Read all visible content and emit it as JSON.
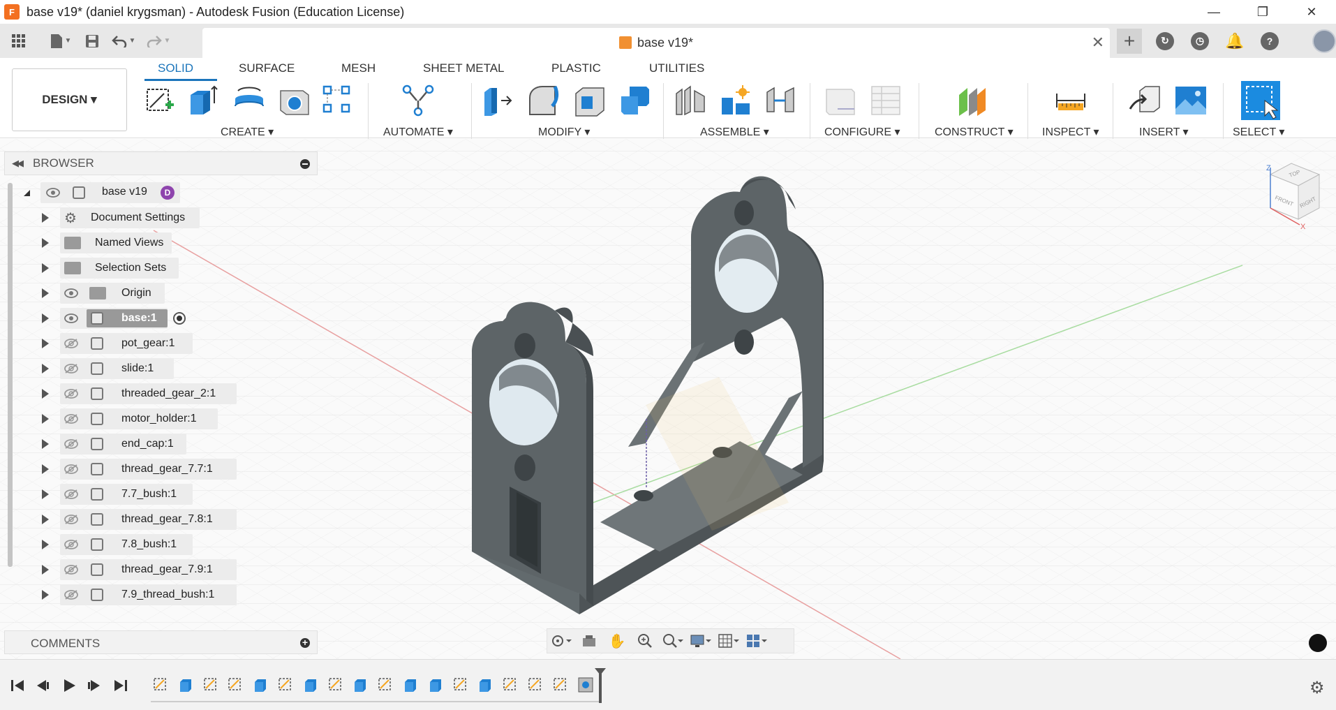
{
  "window": {
    "title": "base v19* (daniel krygsman) - Autodesk Fusion (Education License)",
    "app_icon_label": "F",
    "minimize_glyph": "—",
    "restore_glyph": "❐",
    "close_glyph": "✕"
  },
  "document_tab": {
    "label": "base v19*",
    "close_glyph": "✕"
  },
  "header_icons": {
    "grid": "app-grid-icon",
    "file": "file-icon",
    "save": "save-icon",
    "undo": "undo-icon",
    "redo": "redo-icon",
    "new_tab": "+",
    "extensions": "extensions-icon",
    "job_status": "clock-icon",
    "notifications": "bell-icon",
    "help": "?"
  },
  "toolbar": {
    "workspace_button": "DESIGN ▾",
    "tabs": [
      {
        "label": "SOLID",
        "active": true
      },
      {
        "label": "SURFACE",
        "active": false
      },
      {
        "label": "MESH",
        "active": false
      },
      {
        "label": "SHEET METAL",
        "active": false
      },
      {
        "label": "PLASTIC",
        "active": false
      },
      {
        "label": "UTILITIES",
        "active": false
      }
    ],
    "groups": [
      {
        "label": "CREATE ▾"
      },
      {
        "label": "AUTOMATE ▾"
      },
      {
        "label": "MODIFY ▾"
      },
      {
        "label": "ASSEMBLE ▾"
      },
      {
        "label": "CONFIGURE ▾"
      },
      {
        "label": "CONSTRUCT ▾"
      },
      {
        "label": "INSPECT ▾"
      },
      {
        "label": "INSERT ▾"
      },
      {
        "label": "SELECT ▾"
      }
    ]
  },
  "browser": {
    "title": "BROWSER",
    "collapse_glyph": "◀◀",
    "root": {
      "label": "base v19",
      "badge": "D"
    },
    "items": [
      {
        "label": "Document Settings",
        "kind": "settings",
        "visible": null,
        "selected": false
      },
      {
        "label": "Named Views",
        "kind": "folder",
        "visible": null,
        "selected": false
      },
      {
        "label": "Selection Sets",
        "kind": "folder",
        "visible": null,
        "selected": false
      },
      {
        "label": "Origin",
        "kind": "folder",
        "visible": true,
        "selected": false
      },
      {
        "label": "base:1",
        "kind": "body",
        "visible": true,
        "selected": true
      },
      {
        "label": "pot_gear:1",
        "kind": "body",
        "visible": false,
        "selected": false
      },
      {
        "label": "slide:1",
        "kind": "body",
        "visible": false,
        "selected": false
      },
      {
        "label": "threaded_gear_2:1",
        "kind": "body",
        "visible": false,
        "selected": false
      },
      {
        "label": "motor_holder:1",
        "kind": "body",
        "visible": false,
        "selected": false
      },
      {
        "label": "end_cap:1",
        "kind": "body",
        "visible": false,
        "selected": false
      },
      {
        "label": "thread_gear_7.7:1",
        "kind": "body",
        "visible": false,
        "selected": false
      },
      {
        "label": "7.7_bush:1",
        "kind": "body",
        "visible": false,
        "selected": false
      },
      {
        "label": "thread_gear_7.8:1",
        "kind": "body",
        "visible": false,
        "selected": false
      },
      {
        "label": "7.8_bush:1",
        "kind": "body",
        "visible": false,
        "selected": false
      },
      {
        "label": "thread_gear_7.9:1",
        "kind": "body",
        "visible": false,
        "selected": false
      },
      {
        "label": "7.9_thread_bush:1",
        "kind": "body",
        "visible": false,
        "selected": false
      }
    ]
  },
  "comments": {
    "title": "COMMENTS",
    "add_glyph": "+"
  },
  "viewcube": {
    "top": "TOP",
    "front": "FRONT",
    "right": "RIGHT",
    "axis_z": "Z",
    "axis_x": "X"
  },
  "timeline": {
    "feature_count": 18,
    "feature_kinds": [
      "sketch",
      "extrude",
      "sketch",
      "sketch",
      "extrude",
      "sketch",
      "extrude",
      "sketch",
      "extrude",
      "sketch",
      "extrude",
      "extrude",
      "sketch",
      "extrude",
      "sketch",
      "sketch",
      "sketch",
      "component"
    ]
  },
  "colors": {
    "accent": "#1b75bb",
    "model_gray": "#5f6568",
    "fusion_orange": "#f37021"
  }
}
